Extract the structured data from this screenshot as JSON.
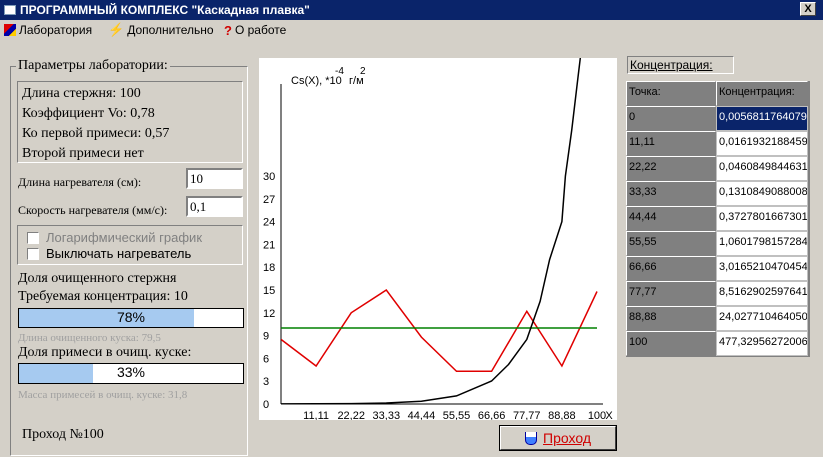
{
  "window": {
    "title": "ПРОГРАММНЫЙ КОМПЛЕКС \"Каскадная плавка\"",
    "close_glyph": "X"
  },
  "menu": [
    {
      "label": "Лаборатория",
      "icon": "lab-flask-icon"
    },
    {
      "label": "Дополнительно",
      "icon": "lightning-icon"
    },
    {
      "label": "О работе",
      "icon": "question-icon"
    }
  ],
  "params": {
    "legend": "Параметры лаборатории:",
    "lines": [
      "Длина стержня: 100",
      "Коэффициент Vo: 0,78",
      "Ко первой примеси: 0,57",
      "Второй примеси нет"
    ],
    "heater_length_label": "Длина нагревателя (см):",
    "heater_length_value": "10",
    "heater_speed_label": "Скорость нагревателя (мм/с):",
    "heater_speed_value": "0,1",
    "log_graph_label": "Логарифмический график",
    "log_graph_checked": false,
    "heater_off_label": "Выключать нагреватель",
    "heater_off_checked": false
  },
  "purity": {
    "title": "Доля очищенного стержня",
    "required_label": "Требуемая концентрация: 10",
    "percent_text": "78%",
    "percent_value": 0.78,
    "cleaned_length": "Длина очищенного куска: 79,5"
  },
  "impurity": {
    "title": "Доля примеси в очищ. куске:",
    "percent_text": "33%",
    "percent_value": 0.33,
    "mass_text": "Масса примесей в очищ. куске: 31,8"
  },
  "pass_label": "Проход №100",
  "pass_button": "Проход",
  "chart_data": {
    "type": "line",
    "y_axis_label": "Cs(X), *10",
    "y_axis_exp": "-4",
    "y_axis_unit": "г/м",
    "y_axis_unit_exp": "2",
    "x_axis_label": "X",
    "x_ticks": [
      "11,11",
      "22,22",
      "33,33",
      "44,44",
      "55,55",
      "66,66",
      "77,77",
      "88,88",
      "100"
    ],
    "y_ticks": [
      "0",
      "3",
      "6",
      "9",
      "12",
      "15",
      "18",
      "21",
      "24",
      "27",
      "30"
    ],
    "xlim": [
      0,
      100
    ],
    "ylim": [
      0,
      30
    ],
    "series": [
      {
        "color": "#e00000",
        "x": [
          0,
          11.11,
          22.22,
          33.33,
          44.44,
          55.55,
          66.66,
          77.77,
          88.88,
          100
        ],
        "y": [
          8.5,
          5.0,
          12.0,
          15.0,
          8.8,
          4.3,
          4.3,
          12.2,
          5.0,
          14.8
        ]
      },
      {
        "color": "#008000",
        "x": [
          0,
          100
        ],
        "y": [
          10,
          10
        ]
      },
      {
        "color": "#000000",
        "x": [
          0,
          11.11,
          22.22,
          33.33,
          44.44,
          55.55,
          66.66,
          72,
          77.77,
          82,
          85,
          88.88,
          90,
          92,
          94,
          96,
          97
        ],
        "y": [
          0.01,
          0.02,
          0.05,
          0.13,
          0.37,
          1.06,
          3.02,
          5.2,
          8.5,
          13.5,
          19,
          24,
          30,
          36,
          43,
          50,
          55
        ]
      }
    ]
  },
  "table": {
    "heading": "Концентрация:",
    "col_point": "Точка:",
    "col_conc": "Концентрация:",
    "rows": [
      [
        "0",
        "0,0056811764079"
      ],
      [
        "11,11",
        "0,0161932188459"
      ],
      [
        "22,22",
        "0,0460849844631"
      ],
      [
        "33,33",
        "0,1310849088008"
      ],
      [
        "44,44",
        "0,3727801667301"
      ],
      [
        "55,55",
        "1,0601798157284"
      ],
      [
        "66,66",
        "3,0165210470454"
      ],
      [
        "77,77",
        "8,5162902597641"
      ],
      [
        "88,88",
        "24,027710464050"
      ],
      [
        "100",
        "477,32956272006"
      ]
    ]
  }
}
